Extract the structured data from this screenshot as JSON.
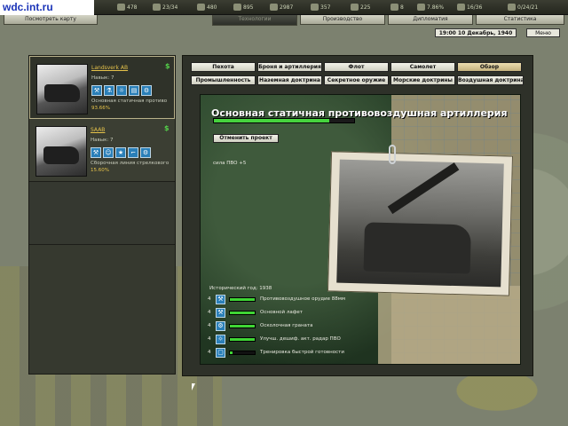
{
  "watermark": "wdc.int.ru",
  "resources": [
    {
      "icon": "manpower-icon",
      "value": "478"
    },
    {
      "icon": "energy-icon",
      "value": "23/34"
    },
    {
      "icon": "metal-icon",
      "value": "480"
    },
    {
      "icon": "rare-materials-icon",
      "value": "895"
    },
    {
      "icon": "oil-icon",
      "value": "2987"
    },
    {
      "icon": "money-icon",
      "value": "357"
    },
    {
      "icon": "supplies-icon",
      "value": "225"
    },
    {
      "icon": "transports-icon",
      "value": "8"
    },
    {
      "icon": "escorts-icon",
      "value": "7.86%"
    },
    {
      "icon": "dissent-icon",
      "value": "16/36"
    },
    {
      "icon": "officers-icon",
      "value": "0/24/21"
    }
  ],
  "tabs": {
    "map": "Посмотреть карту",
    "technology": "Технологии",
    "production": "Производство",
    "diplomacy": "Дипломатия",
    "statistics": "Статистика"
  },
  "date": "19:00 10 Декабрь, 1940",
  "menu": "Меню",
  "companies": [
    {
      "name": "Landsverk AB",
      "skill": "Навык: 7",
      "project": "Основная статичная противо",
      "percent": "93.66%",
      "icons": [
        "wrench-icon",
        "flask-icon",
        "bulb-icon",
        "blueprint-icon",
        "gears-icon"
      ]
    },
    {
      "name": "SAAB",
      "skill": "Навык: 7",
      "project": "Сборочная линия стрелкового",
      "percent": "15.60%",
      "icons": [
        "wrench-icon",
        "person-icon",
        "star-icon",
        "ruler-icon",
        "gears-icon"
      ]
    }
  ],
  "categories_row1": [
    "Пехота",
    "Броня и артиллерия",
    "Флот",
    "Самолет",
    "Обзор"
  ],
  "categories_row2": [
    "Промышленность",
    "Наземная доктрина",
    "Секретное оружие",
    "Морские доктрины",
    "Воздушная доктрина"
  ],
  "detail": {
    "title": "Основная статичная противовоздушная артиллерия",
    "progress": 0.82,
    "cancel_label": "Отменить проект",
    "bonus": "сила ПВО +5",
    "historical_year": "Исторический год: 1938"
  },
  "requirements": [
    {
      "level": "4",
      "icon": "wrench-icon",
      "label": "Противовоздушное орудие 88мм",
      "fill": 1.0
    },
    {
      "level": "4",
      "icon": "wrench-icon",
      "label": "Основной лафет",
      "fill": 1.0
    },
    {
      "level": "4",
      "icon": "gears-icon",
      "label": "Осколочная граната",
      "fill": 1.0
    },
    {
      "level": "4",
      "icon": "bulb-icon",
      "label": "Улучш. дешиф. акт. радар ПВО",
      "fill": 1.0
    },
    {
      "level": "4",
      "icon": "blueprint-icon",
      "label": "Тренировка быстрой готовности",
      "fill": 0.1
    }
  ]
}
